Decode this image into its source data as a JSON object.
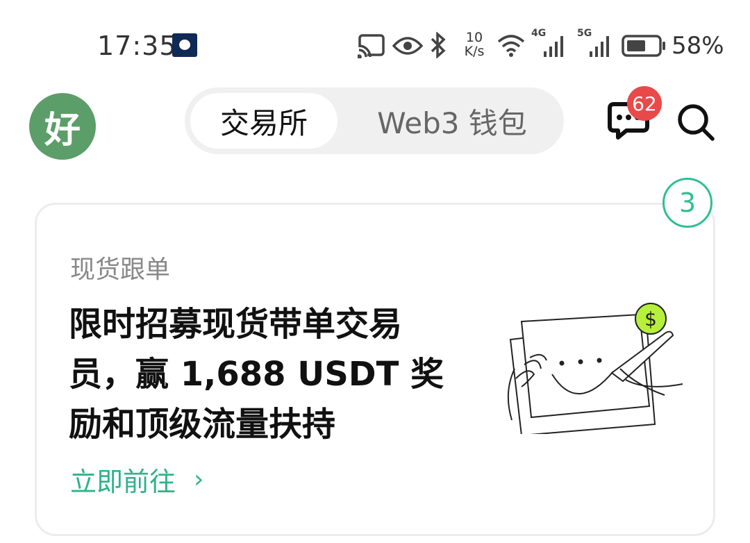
{
  "status_bar": {
    "time": "17:35",
    "net_speed_value": "10",
    "net_speed_unit": "K/s",
    "signal_1_label": "4G",
    "signal_2_label": "5G",
    "battery_percent": "58%"
  },
  "header": {
    "avatar_text": "好",
    "tabs": [
      {
        "label": "交易所",
        "active": true
      },
      {
        "label": "Web3 钱包",
        "active": false
      }
    ],
    "message_badge": "62"
  },
  "card": {
    "count_badge": "3",
    "category": "现货跟单",
    "title_lines": [
      "限时招募现货带单交易",
      "员，赢 1,688 USDT 奖",
      "励和顶级流量扶持"
    ],
    "link_label": "立即前往",
    "link_chevron": "›"
  },
  "colors": {
    "accent_green": "#2fb389",
    "avatar_green": "#5b9e69",
    "badge_red": "#e94949",
    "coin_lime": "#b6f03c"
  }
}
